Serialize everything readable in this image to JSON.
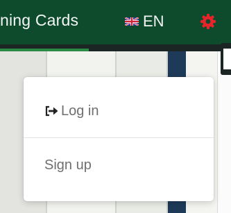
{
  "header": {
    "title": "ning Cards",
    "language": {
      "code": "EN",
      "flag_icon": "uk-flag-icon"
    },
    "settings_icon": "gear-icon",
    "colors": {
      "bar": "#0e4a2c",
      "gear": "#e8242b",
      "progress": "#2a8a43"
    }
  },
  "dropdown": {
    "login": {
      "icon": "sign-in-icon",
      "label": "Log in"
    },
    "signup": {
      "label": "Sign up"
    }
  }
}
